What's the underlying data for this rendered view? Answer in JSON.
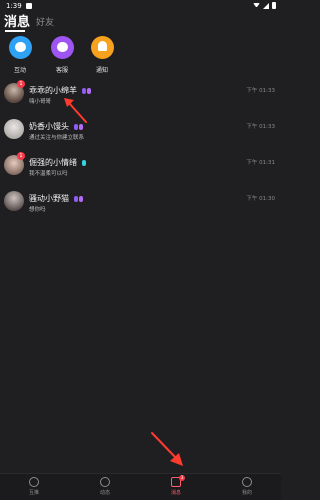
{
  "status_bar": {
    "time": "1:39"
  },
  "tabs": [
    {
      "label": "消息",
      "active": true
    },
    {
      "label": "好友",
      "active": false
    }
  ],
  "quick_actions": [
    {
      "label": "互动",
      "icon": "chat-bubble-icon",
      "color": "#2fa2f6"
    },
    {
      "label": "客服",
      "icon": "headset-icon",
      "color": "#9f55f2"
    },
    {
      "label": "通知",
      "icon": "bell-icon",
      "color": "#f7a21f"
    }
  ],
  "messages": [
    {
      "name": "乖乖的小绵羊",
      "preview": "嗨小哥哥",
      "time": "下午 01:33",
      "unread": "1"
    },
    {
      "name": "奶香小馒头",
      "preview": "通过关注与你建立联系",
      "time": "下午 01:33",
      "unread": ""
    },
    {
      "name": "倔强的小情绪",
      "preview": "我不温柔可以吗",
      "time": "下午 01:31",
      "unread": "1"
    },
    {
      "name": "骚动小野猫",
      "preview": "想你吗",
      "time": "下午 01:30",
      "unread": ""
    }
  ],
  "bottom_nav": [
    {
      "label": "互推",
      "icon": "compass-icon",
      "active": false
    },
    {
      "label": "动态",
      "icon": "planet-icon",
      "active": false
    },
    {
      "label": "消息",
      "icon": "message-icon",
      "active": true,
      "badge": "3"
    },
    {
      "label": "我的",
      "icon": "profile-icon",
      "active": false
    }
  ]
}
